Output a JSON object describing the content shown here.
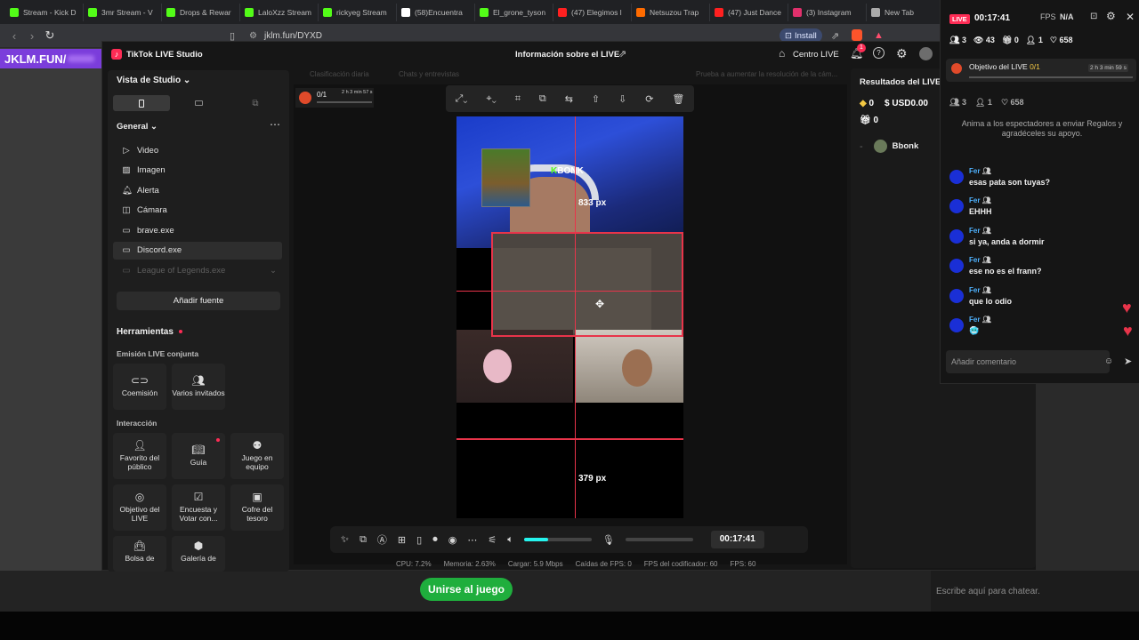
{
  "browser_tabs": [
    {
      "label": "Stream - Kick D",
      "icon": "kick-icon",
      "color": "#53fc18"
    },
    {
      "label": "3mr Stream - V",
      "icon": "kick-icon",
      "color": "#53fc18"
    },
    {
      "label": "Drops & Rewar",
      "icon": "kick-icon",
      "color": "#53fc18"
    },
    {
      "label": "LaloXzz Stream",
      "icon": "kick-icon",
      "color": "#53fc18"
    },
    {
      "label": "rickyeg Stream",
      "icon": "kick-icon",
      "color": "#53fc18"
    },
    {
      "label": "(58)Encuentra",
      "icon": "tiktok-icon",
      "color": "#ffffff"
    },
    {
      "label": "El_grone_tyson",
      "icon": "kick-icon",
      "color": "#53fc18"
    },
    {
      "label": "(47) Elegimos l",
      "icon": "youtube-icon",
      "color": "#ff2020"
    },
    {
      "label": "Netsuzou Trap",
      "icon": "crunchyroll-icon",
      "color": "#ff6b00"
    },
    {
      "label": "(47) Just Dance",
      "icon": "youtube-icon",
      "color": "#ff2020"
    },
    {
      "label": "(3) Instagram",
      "icon": "instagram-icon",
      "color": "#e1306c"
    },
    {
      "label": "New Tab",
      "icon": "shield-icon",
      "color": "#aaaaaa"
    }
  ],
  "browser": {
    "url": "jklm.fun/DYXD",
    "install_label": "Install"
  },
  "page": {
    "brand": "JKLM.FUN/",
    "join_button": "Unirse al juego",
    "chat_placeholder": "Escribe aquí para chatear."
  },
  "studio": {
    "app_title": "TikTok LIVE Studio",
    "center_title": "Información sobre el LIVE",
    "centro_live": "Centro LIVE",
    "notif_count": "1",
    "view_label": "Vista de Studio",
    "general_label": "General",
    "sources": [
      {
        "label": "Video",
        "icon": "play-icon"
      },
      {
        "label": "Imagen",
        "icon": "image-icon"
      },
      {
        "label": "Alerta",
        "icon": "bell-icon"
      },
      {
        "label": "Cámara",
        "icon": "camera-icon"
      },
      {
        "label": "brave.exe",
        "icon": "window-icon"
      },
      {
        "label": "Discord.exe",
        "icon": "window-icon"
      },
      {
        "label": "League of Legends.exe",
        "icon": "window-icon"
      }
    ],
    "add_source": "Añadir fuente",
    "tools_title": "Herramientas",
    "tools_section1": "Emisión LIVE conjunta",
    "tools_coemision": "Coemisión",
    "tools_varios": "Varios invitados",
    "tools_section2": "Interacción",
    "tools_favorito": "Favorito del público",
    "tools_guia": "Guía",
    "tools_juego": "Juego en equipo",
    "tools_objetivo": "Objetivo del LIVE",
    "tools_encuesta": "Encuesta y Votar con...",
    "tools_cofre": "Cofre del tesoro",
    "tools_bolsa": "Bolsa de",
    "tools_galeria": "Galería de",
    "canvas_hints": [
      "Clasificación diaria",
      "Chats y entrevistas",
      "Prueba a aumentar la resolución de la cám..."
    ],
    "goal_progress": "0/1",
    "goal_timer": "2 h 3 min 57 s",
    "preview_overlay_text": "BONK",
    "measure_top": "833 px",
    "measure_bottom": "379 px",
    "timer": "00:17:41",
    "stats": {
      "cpu": "CPU: 7.2%",
      "mem": "Memoria: 2.63%",
      "load": "Cargar: 5.9 Mbps",
      "fps_drops": "Caídas de FPS: 0",
      "encoder_fps": "FPS del codificador: 60",
      "fps": "FPS: 60"
    },
    "results_title": "Resultados del LIVE",
    "coins": "0",
    "usd": "USD0.00",
    "gifts": "0",
    "ranking_name": "Bbonk"
  },
  "overlay": {
    "live_badge": "LIVE",
    "timer": "00:17:41",
    "fps_label": "FPS",
    "fps_value": "N/A",
    "viewers": "3",
    "views": "43",
    "gifts": "0",
    "members": "1",
    "likes": "658",
    "goal_label": "Objetivo del LIVE",
    "goal_progress": "0/1",
    "goal_timer": "2 h 3 min 59 s",
    "viewers2": "3",
    "members2": "1",
    "likes2": "658",
    "encourage": "Anima a los espectadores a enviar Regalos y agradéceles su apoyo.",
    "chat": [
      {
        "name": "Fer",
        "text": "esas pata son tuyas?"
      },
      {
        "name": "Fer",
        "text": "EHHH"
      },
      {
        "name": "Fer",
        "text": "si ya, anda a dormir"
      },
      {
        "name": "Fer",
        "text": "ese no es el frann?"
      },
      {
        "name": "Fer",
        "text": "que lo odio"
      },
      {
        "name": "Fer",
        "text": "🥶"
      }
    ],
    "comment_placeholder": "Añadir comentario"
  }
}
